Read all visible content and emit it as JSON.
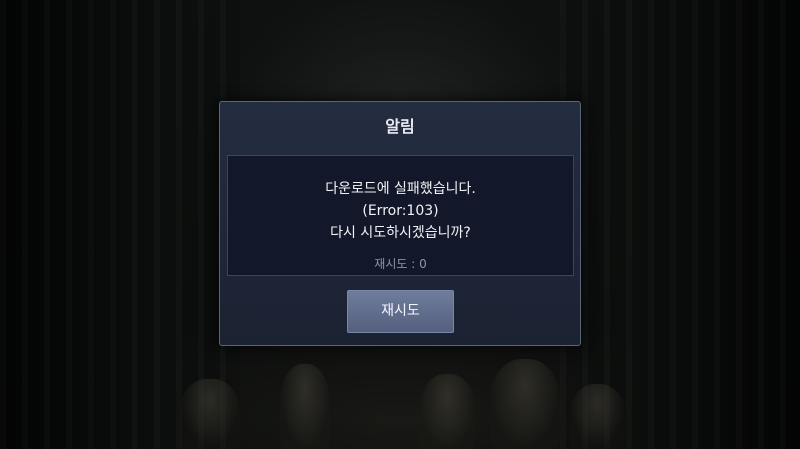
{
  "dialog": {
    "title": "알림",
    "message_lines": [
      "다운로드에 실패했습니다.",
      "(Error:103)",
      "다시 시도하시겠습니까?"
    ],
    "retry_count_label": "재시도 : 0",
    "retry_button_label": "재시도"
  },
  "colors": {
    "dialog_background": "#1f2638",
    "message_background": "#12182a",
    "button_background": "#5f6b8a",
    "border": "#5b6478"
  }
}
